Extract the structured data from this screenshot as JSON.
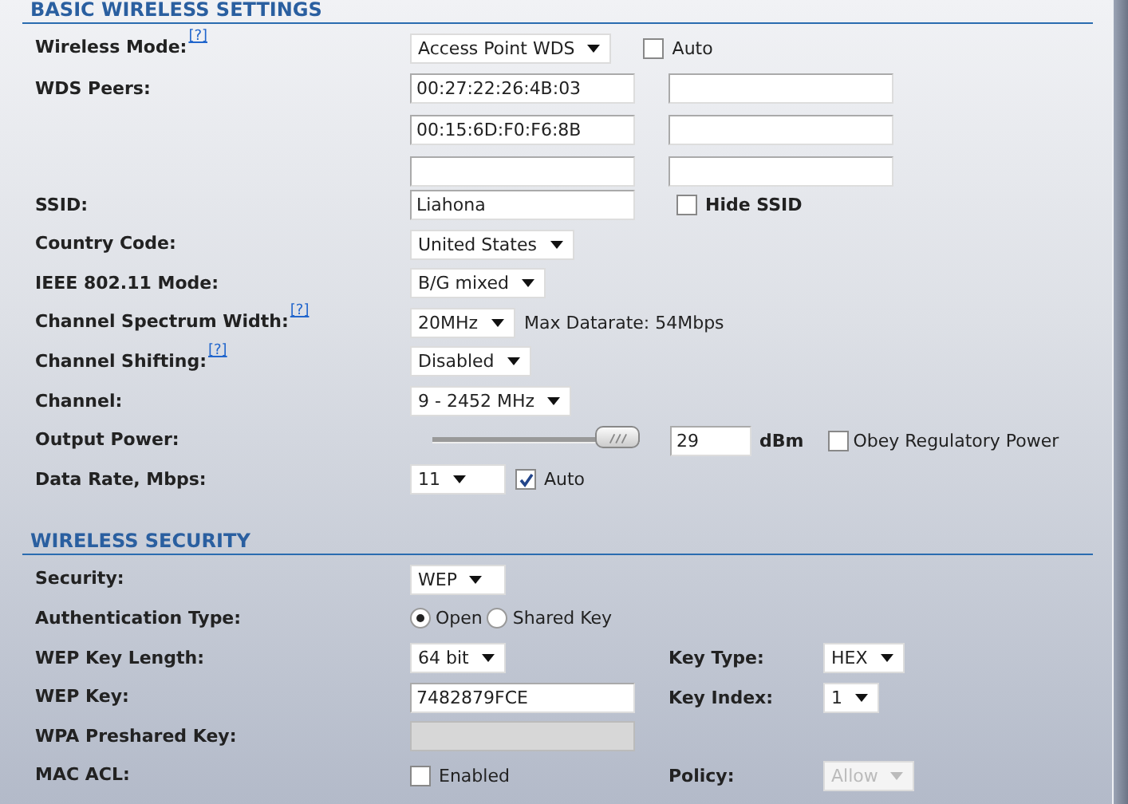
{
  "sections": [
    {
      "title": "BASIC WIRELESS SETTINGS",
      "rows": [
        {
          "kind": "select",
          "label": "Wireless Mode:",
          "help": "[?]",
          "value": "Access Point WDS",
          "extra": {
            "kind": "plain",
            "label": "Auto",
            "checked": false
          }
        },
        {
          "kind": "peers",
          "label": "WDS Peers:",
          "values": [
            "00:27:22:26:4B:03",
            "00:15:6D:F0:F6:8B"
          ]
        },
        {
          "kind": "text",
          "label": "SSID:",
          "value": "Liahona",
          "extra": {
            "kind": "bold",
            "label": "Hide SSID",
            "checked": false
          }
        },
        {
          "kind": "select",
          "label": "Country Code:",
          "value": "United States"
        },
        {
          "kind": "select",
          "label": "IEEE 802.11 Mode:",
          "value": "B/G mixed"
        },
        {
          "kind": "select",
          "label": "Channel Spectrum Width:",
          "help": "[?]",
          "value": "20MHz",
          "note": "Max Datarate: 54Mbps"
        },
        {
          "kind": "select",
          "label": "Channel Shifting:",
          "help": "[?]",
          "value": "Disabled"
        },
        {
          "kind": "select",
          "label": "Channel:",
          "value": "9 - 2452 MHz"
        },
        {
          "kind": "slider",
          "label": "Output Power:",
          "level": 1,
          "value": "29",
          "unit": "dBm",
          "extra": {
            "kind": "plain",
            "label": "Obey Regulatory Power",
            "checked": false
          }
        },
        {
          "kind": "select",
          "label": "Data Rate, Mbps:",
          "value": "11",
          "extra": {
            "kind": "plain",
            "label": "Auto",
            "checked": true
          }
        }
      ]
    },
    {
      "title": "WIRELESS SECURITY",
      "rows": [
        {
          "kind": "select",
          "label": "Security:",
          "value": "WEP"
        },
        {
          "kind": "radio",
          "label": "Authentication Type:",
          "options": [
            {
              "label": "Open",
              "selected": true
            },
            {
              "label": "Shared Key",
              "selected": false
            }
          ]
        },
        {
          "kind": "select",
          "label": "WEP Key Length:",
          "value": "64 bit",
          "side": {
            "kind": "select",
            "label": "Key Type:",
            "value": "HEX"
          }
        },
        {
          "kind": "text",
          "label": "WEP Key:",
          "value": "7482879FCE",
          "side": {
            "kind": "select",
            "label": "Key Index:",
            "value": "1"
          }
        },
        {
          "kind": "text",
          "label": "WPA Preshared Key:",
          "disabled": true
        },
        {
          "kind": "checkbox",
          "label": "MAC ACL:",
          "option": {
            "label": "Enabled",
            "checked": false
          },
          "side": {
            "kind": "select",
            "label": "Policy:",
            "value": "Allow",
            "disabled": true
          }
        }
      ]
    }
  ]
}
